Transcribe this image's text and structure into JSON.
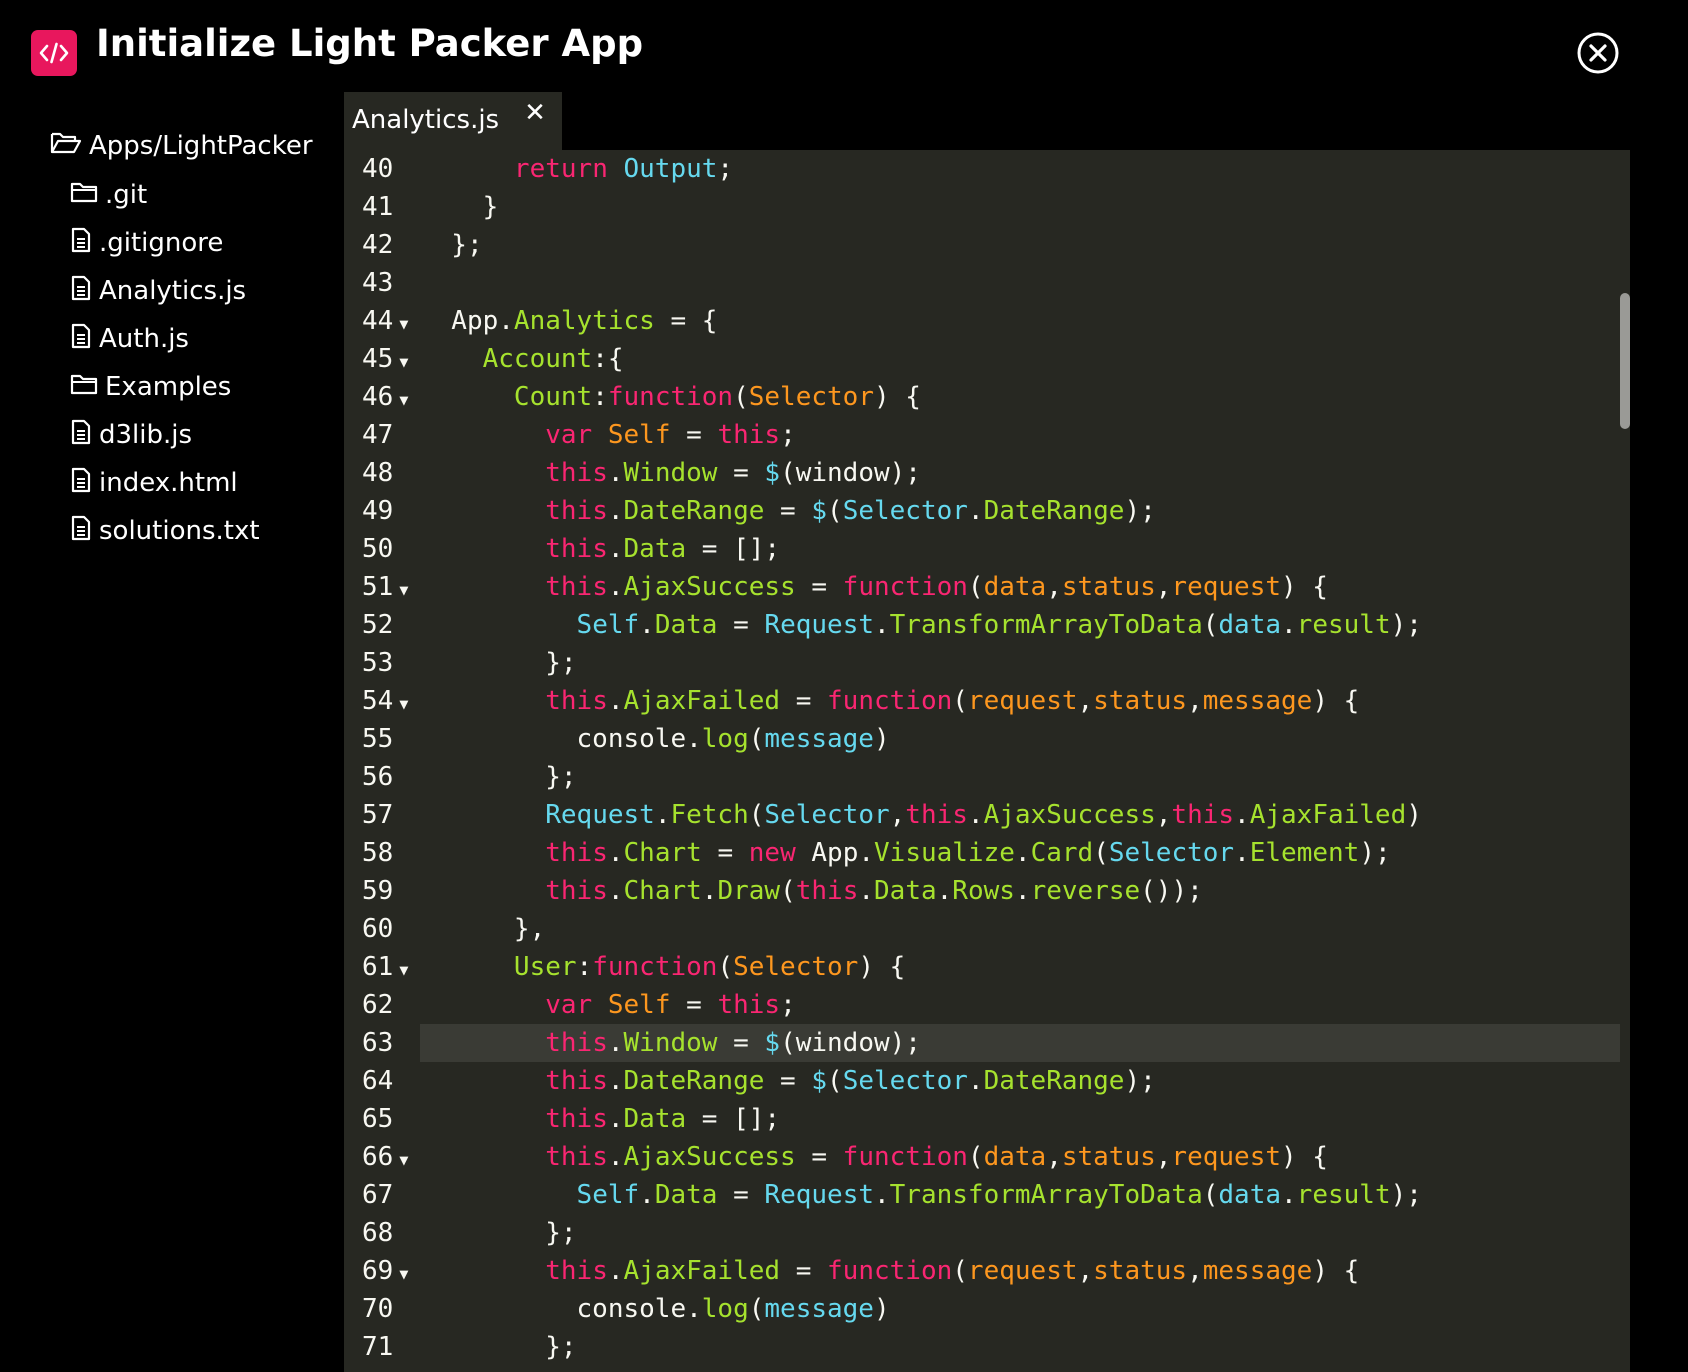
{
  "header": {
    "title": "Initialize Light Packer App",
    "logo_glyph": "</>",
    "brand_color": "#e8175d"
  },
  "sidebar": {
    "root": {
      "label": "Apps/LightPacker",
      "icon": "folder-open-icon"
    },
    "items": [
      {
        "label": ".git",
        "icon": "folder-icon"
      },
      {
        "label": ".gitignore",
        "icon": "file-icon"
      },
      {
        "label": "Analytics.js",
        "icon": "file-icon"
      },
      {
        "label": "Auth.js",
        "icon": "file-icon"
      },
      {
        "label": "Examples",
        "icon": "folder-icon"
      },
      {
        "label": "d3lib.js",
        "icon": "file-icon"
      },
      {
        "label": "index.html",
        "icon": "file-icon"
      },
      {
        "label": "solutions.txt",
        "icon": "file-icon"
      }
    ]
  },
  "tabs": [
    {
      "label": "Analytics.js",
      "close": "✕",
      "active": true
    }
  ],
  "editor": {
    "theme": {
      "background": "#272822",
      "keyword": "#f92672",
      "name": "#a6e22e",
      "param": "#fd971f",
      "type": "#66d9ef",
      "text": "#f8f8f2"
    },
    "active_line": 63,
    "lines": [
      {
        "num": "40",
        "fold": false,
        "tokens": [
          [
            "d",
            "      "
          ],
          [
            "k",
            "return"
          ],
          [
            "d",
            " "
          ],
          [
            "c",
            "Output"
          ],
          [
            "d",
            ";"
          ]
        ]
      },
      {
        "num": "41",
        "fold": false,
        "tokens": [
          [
            "d",
            "    }"
          ]
        ]
      },
      {
        "num": "42",
        "fold": false,
        "tokens": [
          [
            "d",
            "  };"
          ]
        ]
      },
      {
        "num": "43",
        "fold": false,
        "tokens": [
          [
            "d",
            ""
          ]
        ]
      },
      {
        "num": "44",
        "fold": true,
        "tokens": [
          [
            "d",
            "  App."
          ],
          [
            "n",
            "Analytics"
          ],
          [
            "d",
            " = {"
          ]
        ]
      },
      {
        "num": "45",
        "fold": true,
        "tokens": [
          [
            "d",
            "    "
          ],
          [
            "n",
            "Account"
          ],
          [
            "d",
            ":{"
          ]
        ]
      },
      {
        "num": "46",
        "fold": true,
        "tokens": [
          [
            "d",
            "      "
          ],
          [
            "n",
            "Count"
          ],
          [
            "d",
            ":"
          ],
          [
            "k",
            "function"
          ],
          [
            "d",
            "("
          ],
          [
            "p",
            "Selector"
          ],
          [
            "d",
            ") {"
          ]
        ]
      },
      {
        "num": "47",
        "fold": false,
        "tokens": [
          [
            "d",
            "        "
          ],
          [
            "k",
            "var"
          ],
          [
            "d",
            " "
          ],
          [
            "p",
            "Self"
          ],
          [
            "d",
            " = "
          ],
          [
            "k",
            "this"
          ],
          [
            "d",
            ";"
          ]
        ]
      },
      {
        "num": "48",
        "fold": false,
        "tokens": [
          [
            "d",
            "        "
          ],
          [
            "k",
            "this"
          ],
          [
            "d",
            "."
          ],
          [
            "n",
            "Window"
          ],
          [
            "d",
            " = "
          ],
          [
            "c",
            "$"
          ],
          [
            "d",
            "(window);"
          ]
        ]
      },
      {
        "num": "49",
        "fold": false,
        "tokens": [
          [
            "d",
            "        "
          ],
          [
            "k",
            "this"
          ],
          [
            "d",
            "."
          ],
          [
            "n",
            "DateRange"
          ],
          [
            "d",
            " = "
          ],
          [
            "c",
            "$"
          ],
          [
            "d",
            "("
          ],
          [
            "c",
            "Selector"
          ],
          [
            "d",
            "."
          ],
          [
            "n",
            "DateRange"
          ],
          [
            "d",
            ");"
          ]
        ]
      },
      {
        "num": "50",
        "fold": false,
        "tokens": [
          [
            "d",
            "        "
          ],
          [
            "k",
            "this"
          ],
          [
            "d",
            "."
          ],
          [
            "n",
            "Data"
          ],
          [
            "d",
            " = "
          ],
          [
            "d",
            "[];"
          ]
        ]
      },
      {
        "num": "51",
        "fold": true,
        "tokens": [
          [
            "d",
            "        "
          ],
          [
            "k",
            "this"
          ],
          [
            "d",
            "."
          ],
          [
            "n",
            "AjaxSuccess"
          ],
          [
            "d",
            " = "
          ],
          [
            "k",
            "function"
          ],
          [
            "d",
            "("
          ],
          [
            "p",
            "data"
          ],
          [
            "d",
            ","
          ],
          [
            "p",
            "status"
          ],
          [
            "d",
            ","
          ],
          [
            "p",
            "request"
          ],
          [
            "d",
            ") {"
          ]
        ]
      },
      {
        "num": "52",
        "fold": false,
        "tokens": [
          [
            "d",
            "          "
          ],
          [
            "c",
            "Self"
          ],
          [
            "d",
            "."
          ],
          [
            "n",
            "Data"
          ],
          [
            "d",
            " = "
          ],
          [
            "c",
            "Request"
          ],
          [
            "d",
            "."
          ],
          [
            "n",
            "TransformArrayToData"
          ],
          [
            "d",
            "("
          ],
          [
            "c",
            "data"
          ],
          [
            "d",
            "."
          ],
          [
            "n",
            "result"
          ],
          [
            "d",
            ");"
          ]
        ]
      },
      {
        "num": "53",
        "fold": false,
        "tokens": [
          [
            "d",
            "        };"
          ]
        ]
      },
      {
        "num": "54",
        "fold": true,
        "tokens": [
          [
            "d",
            "        "
          ],
          [
            "k",
            "this"
          ],
          [
            "d",
            "."
          ],
          [
            "n",
            "AjaxFailed"
          ],
          [
            "d",
            " = "
          ],
          [
            "k",
            "function"
          ],
          [
            "d",
            "("
          ],
          [
            "p",
            "request"
          ],
          [
            "d",
            ","
          ],
          [
            "p",
            "status"
          ],
          [
            "d",
            ","
          ],
          [
            "p",
            "message"
          ],
          [
            "d",
            ") {"
          ]
        ]
      },
      {
        "num": "55",
        "fold": false,
        "tokens": [
          [
            "d",
            "          console."
          ],
          [
            "n",
            "log"
          ],
          [
            "d",
            "("
          ],
          [
            "c",
            "message"
          ],
          [
            "d",
            ")"
          ]
        ]
      },
      {
        "num": "56",
        "fold": false,
        "tokens": [
          [
            "d",
            "        };"
          ]
        ]
      },
      {
        "num": "57",
        "fold": false,
        "tokens": [
          [
            "d",
            "        "
          ],
          [
            "c",
            "Request"
          ],
          [
            "d",
            "."
          ],
          [
            "n",
            "Fetch"
          ],
          [
            "d",
            "("
          ],
          [
            "c",
            "Selector"
          ],
          [
            "d",
            ","
          ],
          [
            "k",
            "this"
          ],
          [
            "d",
            "."
          ],
          [
            "n",
            "AjaxSuccess"
          ],
          [
            "d",
            ","
          ],
          [
            "k",
            "this"
          ],
          [
            "d",
            "."
          ],
          [
            "n",
            "AjaxFailed"
          ],
          [
            "d",
            ")"
          ]
        ]
      },
      {
        "num": "58",
        "fold": false,
        "tokens": [
          [
            "d",
            "        "
          ],
          [
            "k",
            "this"
          ],
          [
            "d",
            "."
          ],
          [
            "n",
            "Chart"
          ],
          [
            "d",
            " = "
          ],
          [
            "k",
            "new"
          ],
          [
            "d",
            " App."
          ],
          [
            "n",
            "Visualize"
          ],
          [
            "d",
            "."
          ],
          [
            "n",
            "Card"
          ],
          [
            "d",
            "("
          ],
          [
            "c",
            "Selector"
          ],
          [
            "d",
            "."
          ],
          [
            "n",
            "Element"
          ],
          [
            "d",
            ");"
          ]
        ]
      },
      {
        "num": "59",
        "fold": false,
        "tokens": [
          [
            "d",
            "        "
          ],
          [
            "k",
            "this"
          ],
          [
            "d",
            "."
          ],
          [
            "n",
            "Chart"
          ],
          [
            "d",
            "."
          ],
          [
            "n",
            "Draw"
          ],
          [
            "d",
            "("
          ],
          [
            "k",
            "this"
          ],
          [
            "d",
            "."
          ],
          [
            "n",
            "Data"
          ],
          [
            "d",
            "."
          ],
          [
            "n",
            "Rows"
          ],
          [
            "d",
            "."
          ],
          [
            "n",
            "reverse"
          ],
          [
            "d",
            "());"
          ]
        ]
      },
      {
        "num": "60",
        "fold": false,
        "tokens": [
          [
            "d",
            "      },"
          ]
        ]
      },
      {
        "num": "61",
        "fold": true,
        "tokens": [
          [
            "d",
            "      "
          ],
          [
            "n",
            "User"
          ],
          [
            "d",
            ":"
          ],
          [
            "k",
            "function"
          ],
          [
            "d",
            "("
          ],
          [
            "p",
            "Selector"
          ],
          [
            "d",
            ") {"
          ]
        ]
      },
      {
        "num": "62",
        "fold": false,
        "tokens": [
          [
            "d",
            "        "
          ],
          [
            "k",
            "var"
          ],
          [
            "d",
            " "
          ],
          [
            "p",
            "Self"
          ],
          [
            "d",
            " = "
          ],
          [
            "k",
            "this"
          ],
          [
            "d",
            ";"
          ]
        ]
      },
      {
        "num": "63",
        "fold": false,
        "tokens": [
          [
            "d",
            "        "
          ],
          [
            "k",
            "this"
          ],
          [
            "d",
            "."
          ],
          [
            "n",
            "Window"
          ],
          [
            "d",
            " = "
          ],
          [
            "c",
            "$"
          ],
          [
            "d",
            "(window);"
          ]
        ]
      },
      {
        "num": "64",
        "fold": false,
        "tokens": [
          [
            "d",
            "        "
          ],
          [
            "k",
            "this"
          ],
          [
            "d",
            "."
          ],
          [
            "n",
            "DateRange"
          ],
          [
            "d",
            " = "
          ],
          [
            "c",
            "$"
          ],
          [
            "d",
            "("
          ],
          [
            "c",
            "Selector"
          ],
          [
            "d",
            "."
          ],
          [
            "n",
            "DateRange"
          ],
          [
            "d",
            ");"
          ]
        ]
      },
      {
        "num": "65",
        "fold": false,
        "tokens": [
          [
            "d",
            "        "
          ],
          [
            "k",
            "this"
          ],
          [
            "d",
            "."
          ],
          [
            "n",
            "Data"
          ],
          [
            "d",
            " = "
          ],
          [
            "d",
            "[];"
          ]
        ]
      },
      {
        "num": "66",
        "fold": true,
        "tokens": [
          [
            "d",
            "        "
          ],
          [
            "k",
            "this"
          ],
          [
            "d",
            "."
          ],
          [
            "n",
            "AjaxSuccess"
          ],
          [
            "d",
            " = "
          ],
          [
            "k",
            "function"
          ],
          [
            "d",
            "("
          ],
          [
            "p",
            "data"
          ],
          [
            "d",
            ","
          ],
          [
            "p",
            "status"
          ],
          [
            "d",
            ","
          ],
          [
            "p",
            "request"
          ],
          [
            "d",
            ") {"
          ]
        ]
      },
      {
        "num": "67",
        "fold": false,
        "tokens": [
          [
            "d",
            "          "
          ],
          [
            "c",
            "Self"
          ],
          [
            "d",
            "."
          ],
          [
            "n",
            "Data"
          ],
          [
            "d",
            " = "
          ],
          [
            "c",
            "Request"
          ],
          [
            "d",
            "."
          ],
          [
            "n",
            "TransformArrayToData"
          ],
          [
            "d",
            "("
          ],
          [
            "c",
            "data"
          ],
          [
            "d",
            "."
          ],
          [
            "n",
            "result"
          ],
          [
            "d",
            ");"
          ]
        ]
      },
      {
        "num": "68",
        "fold": false,
        "tokens": [
          [
            "d",
            "        };"
          ]
        ]
      },
      {
        "num": "69",
        "fold": true,
        "tokens": [
          [
            "d",
            "        "
          ],
          [
            "k",
            "this"
          ],
          [
            "d",
            "."
          ],
          [
            "n",
            "AjaxFailed"
          ],
          [
            "d",
            " = "
          ],
          [
            "k",
            "function"
          ],
          [
            "d",
            "("
          ],
          [
            "p",
            "request"
          ],
          [
            "d",
            ","
          ],
          [
            "p",
            "status"
          ],
          [
            "d",
            ","
          ],
          [
            "p",
            "message"
          ],
          [
            "d",
            ") {"
          ]
        ]
      },
      {
        "num": "70",
        "fold": false,
        "tokens": [
          [
            "d",
            "          console."
          ],
          [
            "n",
            "log"
          ],
          [
            "d",
            "("
          ],
          [
            "c",
            "message"
          ],
          [
            "d",
            ")"
          ]
        ]
      },
      {
        "num": "71",
        "fold": false,
        "tokens": [
          [
            "d",
            "        };"
          ]
        ]
      }
    ]
  }
}
